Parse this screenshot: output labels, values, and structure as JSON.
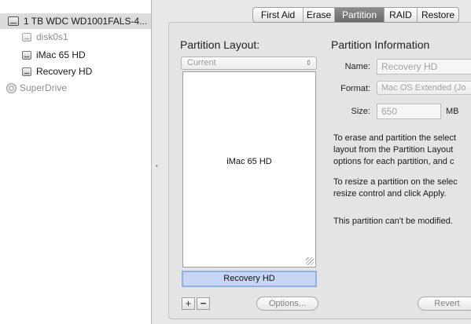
{
  "sidebar": {
    "disk_label": "1 TB WDC WD1001FALS-4...",
    "volumes": [
      "disk0s1",
      "iMac 65 HD",
      "Recovery HD"
    ],
    "drive_label": "SuperDrive"
  },
  "tabs": [
    "First Aid",
    "Erase",
    "Partition",
    "RAID",
    "Restore"
  ],
  "selected_tab": "Partition",
  "layout": {
    "title": "Partition Layout:",
    "current_value": "Current",
    "partition_label": "iMac 65 HD",
    "selected_partition": "Recovery HD",
    "add_symbol": "+",
    "remove_symbol": "−",
    "options_label": "Options..."
  },
  "info": {
    "title": "Partition Information",
    "name_label": "Name:",
    "name_value": "Recovery HD",
    "format_label": "Format:",
    "format_value": "Mac OS Extended (Jo",
    "size_label": "Size:",
    "size_value": "650",
    "size_unit": "MB",
    "text1": [
      "To erase and partition the select",
      "layout from the Partition Layout",
      "options for each partition, and c"
    ],
    "text2": [
      "To resize a partition on the selec",
      "resize control and click Apply."
    ],
    "text3": "This partition can't be modified."
  },
  "revert_label": "Revert",
  "colors": {
    "selection": "#c6d6f4",
    "selected_tab": "#7a7a7a"
  }
}
